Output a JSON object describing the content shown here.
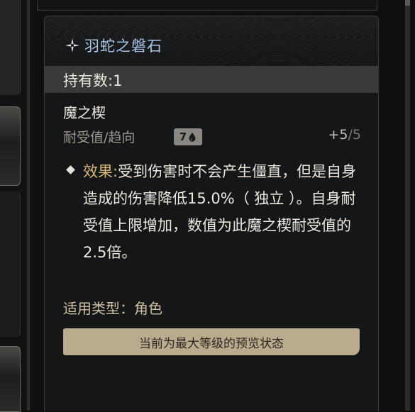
{
  "item": {
    "name": "羽蛇之磐石",
    "held_label": "持有数:1",
    "category": "魔之楔",
    "tolerance_label": "耐受值/趋向",
    "tendency_badge": "7",
    "tendency_icon": "water-drop-icon",
    "tolerance_current": "+5",
    "tolerance_max": "/5",
    "effect_label": "效果:",
    "effect_text": "受到伤害时不会产生僵直，但是自身造成的伤害降低15.0%（ 独立 ）。自身耐受值上限增加，数值为此魔之楔耐受值的2.5倍。",
    "apply_label": "适用类型：",
    "apply_value": "角色",
    "preview_label": "当前为最大等级的预览状态"
  },
  "colors": {
    "title": "#a8c6e8",
    "effect_label": "#d7b978",
    "preview_bar": "#b8ab8e",
    "held_bar": "#3a3a3a"
  }
}
